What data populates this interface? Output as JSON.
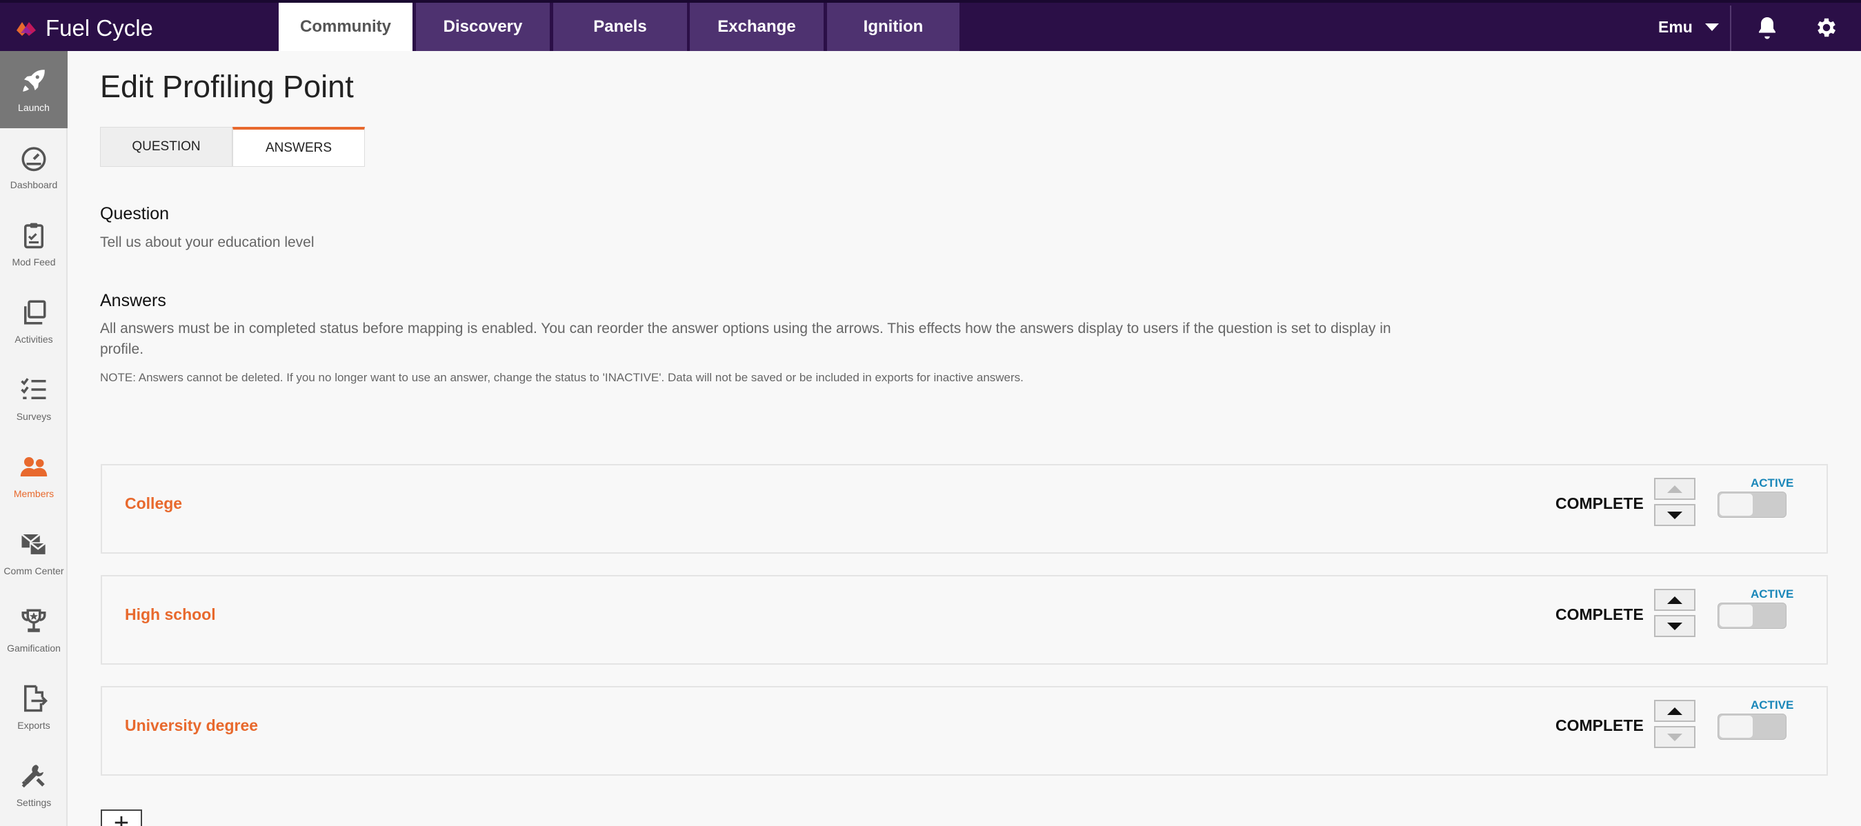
{
  "app": {
    "brand": "Fuel Cycle"
  },
  "nav": {
    "tabs": [
      {
        "label": "Community"
      },
      {
        "label": "Discovery"
      },
      {
        "label": "Panels"
      },
      {
        "label": "Exchange"
      },
      {
        "label": "Ignition"
      }
    ],
    "user": "Emu"
  },
  "sidebar": {
    "items": [
      {
        "label": "Launch",
        "icon": "rocket-icon"
      },
      {
        "label": "Dashboard",
        "icon": "gauge-icon"
      },
      {
        "label": "Mod Feed",
        "icon": "clipboard-icon"
      },
      {
        "label": "Activities",
        "icon": "copy-icon"
      },
      {
        "label": "Surveys",
        "icon": "checklist-icon"
      },
      {
        "label": "Members",
        "icon": "members-icon"
      },
      {
        "label": "Comm Center",
        "icon": "comm-icon"
      },
      {
        "label": "Gamification",
        "icon": "trophy-icon"
      },
      {
        "label": "Exports",
        "icon": "export-icon"
      },
      {
        "label": "Settings",
        "icon": "tools-icon"
      }
    ]
  },
  "page": {
    "title": "Edit Profiling Point",
    "tabs": [
      {
        "label": "QUESTION"
      },
      {
        "label": "ANSWERS"
      }
    ],
    "question_heading": "Question",
    "question_text": "Tell us about your education level",
    "answers_heading": "Answers",
    "answers_description": "All answers must be in completed status before mapping is enabled. You can reorder the answer options using the arrows. This effects how the answers display to users if the question is set to display in profile.",
    "note": "NOTE: Answers cannot be deleted. If you no longer want to use an answer, change the status to 'INACTIVE'. Data will not be saved or be included in exports for inactive answers.",
    "answers": [
      {
        "name": "College",
        "status": "COMPLETE",
        "toggle_label": "ACTIVE"
      },
      {
        "name": "High school",
        "status": "COMPLETE",
        "toggle_label": "ACTIVE"
      },
      {
        "name": "University degree",
        "status": "COMPLETE",
        "toggle_label": "ACTIVE"
      }
    ],
    "add_label": "+"
  },
  "colors": {
    "nav_bg": "#2b0f47",
    "accent": "#e8692d",
    "active_blue": "#1a87b9"
  }
}
